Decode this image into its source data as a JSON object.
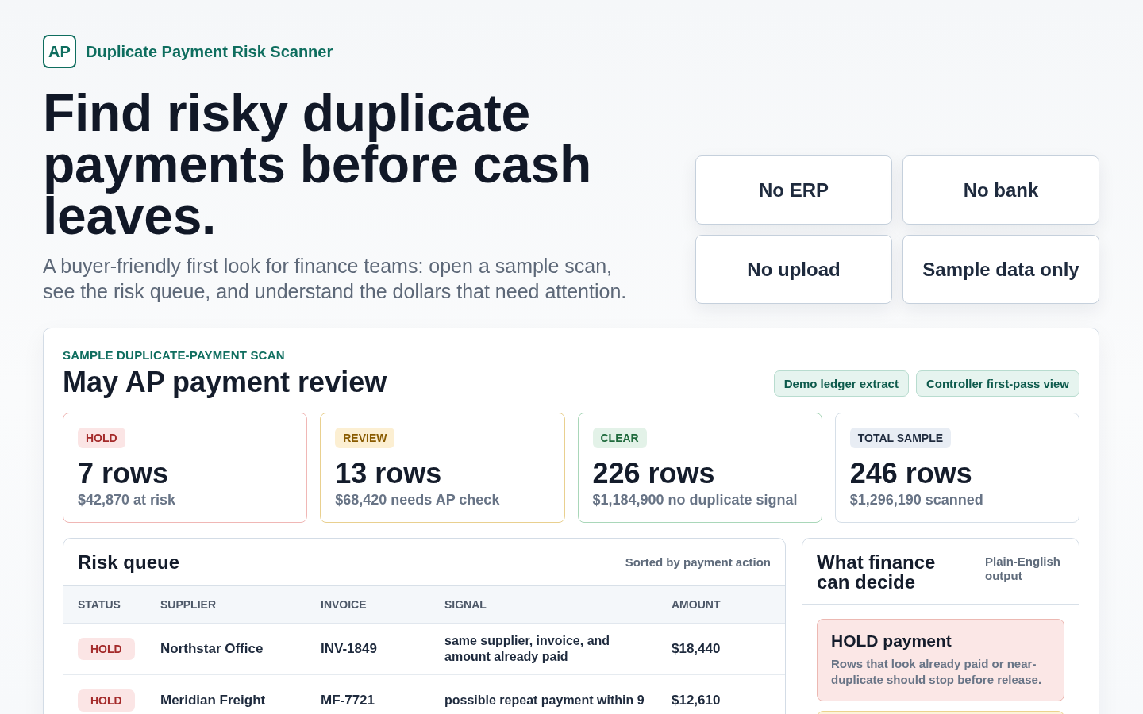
{
  "brand": {
    "mark": "AP",
    "name": "Duplicate Payment Risk Scanner"
  },
  "hero": {
    "title": "Find risky duplicate payments before cash leaves.",
    "subtitle": "A buyer-friendly first look for finance teams: open a sample scan, see the risk queue, and understand the dollars that need attention."
  },
  "assurances": [
    "No ERP",
    "No bank",
    "No upload",
    "Sample data only"
  ],
  "scan": {
    "eyebrow": "SAMPLE DUPLICATE-PAYMENT SCAN",
    "title": "May AP payment review",
    "tags": [
      "Demo ledger extract",
      "Controller first-pass view"
    ],
    "stats": [
      {
        "kind": "hold",
        "label": "HOLD",
        "value": "7 rows",
        "detail": "$42,870 at risk"
      },
      {
        "kind": "review",
        "label": "REVIEW",
        "value": "13 rows",
        "detail": "$68,420 needs AP check"
      },
      {
        "kind": "clear",
        "label": "CLEAR",
        "value": "226 rows",
        "detail": "$1,184,900 no duplicate signal"
      },
      {
        "kind": "total",
        "label": "TOTAL SAMPLE",
        "value": "246 rows",
        "detail": "$1,296,190 scanned"
      }
    ],
    "risk_queue": {
      "title": "Risk queue",
      "note": "Sorted by payment action",
      "columns": [
        "STATUS",
        "SUPPLIER",
        "INVOICE",
        "SIGNAL",
        "AMOUNT"
      ],
      "rows": [
        {
          "status": {
            "kind": "hold",
            "label": "HOLD"
          },
          "supplier": "Northstar Office",
          "invoice": "INV-1849",
          "signal": "same supplier, invoice, and amount already paid",
          "amount": "$18,440"
        },
        {
          "status": {
            "kind": "hold",
            "label": "HOLD"
          },
          "supplier": "Meridian Freight",
          "invoice": "MF-7721",
          "signal": "possible repeat payment within 9",
          "amount": "$12,610"
        }
      ]
    },
    "decisions": {
      "title": "What finance can decide",
      "note": "Plain-English output",
      "cards": [
        {
          "kind": "hold",
          "title": "HOLD payment",
          "text": "Rows that look already paid or near-duplicate should stop before release."
        },
        {
          "kind": "review"
        }
      ]
    }
  }
}
